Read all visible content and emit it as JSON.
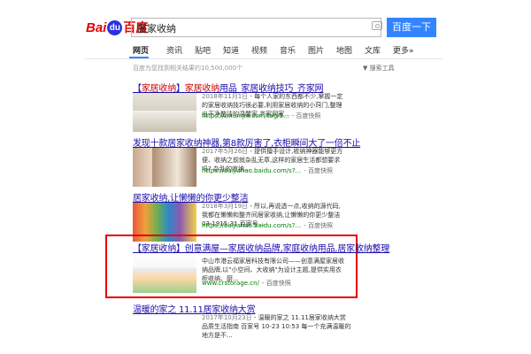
{
  "header": {
    "logo_latin_1": "Bai",
    "logo_paw": "du",
    "logo_cn": "百度",
    "search_value": "居家收纳",
    "search_button": "百度一下"
  },
  "tabs": [
    "网页",
    "资讯",
    "贴吧",
    "知道",
    "视频",
    "音乐",
    "图片",
    "地图",
    "文库",
    "更多»"
  ],
  "result_count": "百度为您找到相关结果约10,500,000个",
  "toolbar": "搜索工具",
  "results": [
    {
      "title_pre": "【",
      "title_hl1": "家居收纳",
      "title_mid": "】",
      "title_hl2": "家居收纳",
      "title_post": "用品_家居收纳技巧_齐家网",
      "date": "2018年11月1日",
      "abstract": " - 每个人家的东西都不少,掌握一定的家居收纳技巧很必要,利用家居收纳的小窍门,整理出干净整洁的温馨家,齐家网家...",
      "url": "https://zixun.jia.com/tag/5...",
      "snap": "- 百度快照"
    },
    {
      "title": "发现十款居家收纳神器,第8款厉害了,衣柜瞬间大了一倍不止",
      "date": "2017年5月26日",
      "abstract": " - 提供擅手设计,收纳神器能够更方便、收纳之前就杂乱无章,这样的家居生活都想要求吗? 杂乱的收纳...",
      "url": "https://baijiahao.baidu.com/s?...",
      "snap": "- 百度快照"
    },
    {
      "title": "居家收纳,让懒懒的你更少整洁",
      "date": "2018年3月19日",
      "abstract": " - 所以,再说透一点,收纳的源代码,我都在懒懒和整齐间居家收纳,让懒懒的你更少整洁 03-1915:31 百家号...",
      "url": "https://baijiahao.baidu.com/s?...",
      "snap": "- 百度快照"
    },
    {
      "title": "【家居收纳】创意满屋—家居收纳品牌,家庭收纳用品,居家收纳整理",
      "abstract": "中山市港云福家居科技有限公司——创意满屋家居收纳品牌,以\"小空间、大收纳\"为设计主题,提供实用衣柜收纳、厨...",
      "url": "www.crstorage.cn/",
      "snap": "- 百度快照"
    },
    {
      "title": "温暖的家之 11.11居家收纳大赏",
      "date": "2017年10月23日",
      "abstract": " - 温暖的家之 11.11居家收纳大赏 品质生活指南 百家号 10-23 10:53 每一个充满温暖的地方是不..."
    }
  ]
}
